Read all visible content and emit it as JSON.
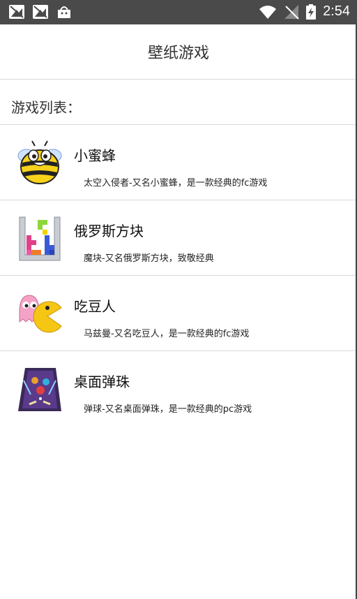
{
  "status_bar": {
    "time": "2:54",
    "left_icons": [
      "image-notification-icon",
      "image-notification-icon",
      "android-store-icon"
    ],
    "right_icons": [
      "wifi-icon",
      "no-signal-icon",
      "battery-charging-icon"
    ]
  },
  "header": {
    "title": "壁纸游戏"
  },
  "section": {
    "label": "游戏列表："
  },
  "games": [
    {
      "name": "小蜜蜂",
      "desc": "太空入侵者-又名小蜜蜂，是一款经典的fc游戏",
      "icon": "bee-game-icon"
    },
    {
      "name": "俄罗斯方块",
      "desc": "魔块-又名俄罗斯方块，致敬经典",
      "icon": "tetris-game-icon"
    },
    {
      "name": "吃豆人",
      "desc": "马兹曼-又名吃豆人，是一款经典的fc游戏",
      "icon": "pacman-game-icon"
    },
    {
      "name": "桌面弹珠",
      "desc": "弹球-又名桌面弹珠，是一款经典的pc游戏",
      "icon": "pinball-game-icon"
    }
  ],
  "colors": {
    "status_bar": "#4a4a4a",
    "divider": "#d8d8d8",
    "text": "#333333"
  }
}
